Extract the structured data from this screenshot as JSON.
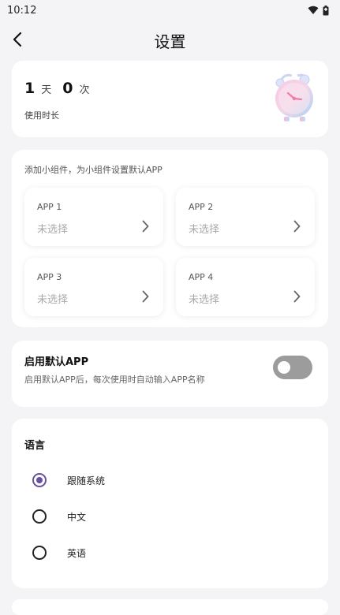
{
  "status_bar": {
    "time": "10:12"
  },
  "header": {
    "title": "设置"
  },
  "usage": {
    "days": "1",
    "days_unit": "天",
    "count": "0",
    "count_unit": "次",
    "label": "使用时长"
  },
  "widgets": {
    "hint": "添加小组件，为小组件设置默认APP",
    "slots": [
      {
        "name": "APP 1",
        "value": "未选择"
      },
      {
        "name": "APP 2",
        "value": "未选择"
      },
      {
        "name": "APP 3",
        "value": "未选择"
      },
      {
        "name": "APP 4",
        "value": "未选择"
      }
    ]
  },
  "default_app": {
    "title": "启用默认APP",
    "description": "启用默认APP后，每次使用时自动输入APP名称",
    "enabled": false
  },
  "language": {
    "title": "语言",
    "options": [
      {
        "label": "跟随系统",
        "selected": true
      },
      {
        "label": "中文",
        "selected": false
      },
      {
        "label": "英语",
        "selected": false
      }
    ]
  },
  "colors": {
    "accent": "#6750a4",
    "background": "#f4f4f6",
    "switch_off": "#9c9c9c"
  }
}
